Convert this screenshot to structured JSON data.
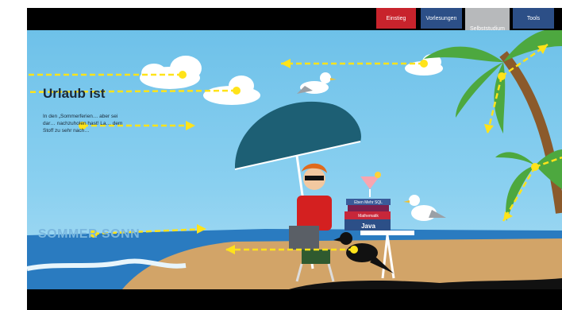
{
  "nav": {
    "tabs": [
      {
        "label": "Einstieg",
        "active": false
      },
      {
        "label": "Vorlesungen",
        "active": false
      },
      {
        "label": "Selbststudium",
        "active": true
      },
      {
        "label": "Tools",
        "active": false
      }
    ]
  },
  "scene": {
    "headline": "Urlaub ist",
    "intro": "In den „Sommerferien… aber sei dar… nachzuholen hast! La… dem Stoff zu sehr nach…",
    "banner": "SOMMER SONN",
    "books": [
      "Eben Mehr SQL",
      "Mathematik",
      "Java"
    ]
  },
  "colors": {
    "tab_red": "#c8232c",
    "tab_blue": "#2c4f87",
    "tab_gray": "#b7b9bb",
    "sky": "#7cc8ec",
    "sand": "#d2a468",
    "arrow": "#ffe31a"
  }
}
